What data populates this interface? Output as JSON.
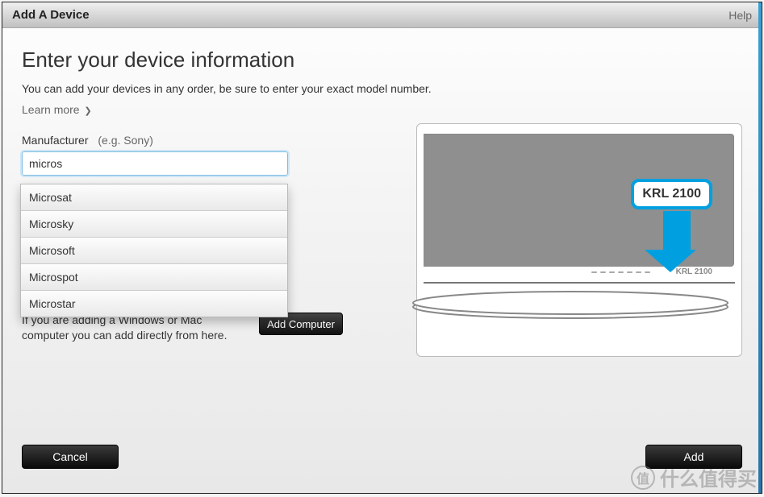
{
  "titlebar": {
    "title": "Add A Device",
    "help": "Help"
  },
  "page": {
    "heading": "Enter your device information",
    "subtext": "You can add your devices in any order, be sure to enter your exact model number.",
    "learn_more": "Learn more"
  },
  "form": {
    "manufacturer_label": "Manufacturer",
    "manufacturer_hint": "(e.g. Sony)",
    "manufacturer_value": "micros",
    "suggestions": [
      "Microsat",
      "Microsky",
      "Microsoft",
      "Microspot",
      "Microstar"
    ]
  },
  "behind": {
    "text": "If you are adding a Windows or Mac computer you can add directly from here.",
    "add_computer": "Add Computer"
  },
  "illustration": {
    "callout": "KRL 2100",
    "model_small": "KRL 2100"
  },
  "footer": {
    "cancel": "Cancel",
    "add": "Add"
  },
  "watermark": {
    "circle": "值",
    "text": "什么值得买"
  }
}
